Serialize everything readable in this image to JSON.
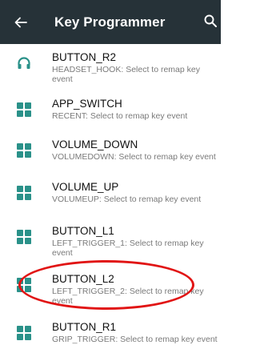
{
  "appbar": {
    "title": "Key Programmer",
    "back_icon": "arrow-back-icon",
    "search_icon": "search-icon",
    "background": "#263238"
  },
  "accent_color": "#2a9189",
  "highlight_color": "#e11414",
  "items": [
    {
      "name": "BUTTON_R2",
      "desc": "HEADSET_HOOK: Select to remap key event",
      "icon": "headset-icon"
    },
    {
      "name": "APP_SWITCH",
      "desc": "RECENT: Select to remap key event",
      "icon": "grid-icon"
    },
    {
      "name": "VOLUME_DOWN",
      "desc": "VOLUMEDOWN: Select to remap key event",
      "icon": "grid-icon"
    },
    {
      "name": "VOLUME_UP",
      "desc": "VOLUMEUP: Select to remap key event",
      "icon": "grid-icon"
    },
    {
      "name": "BUTTON_L1",
      "desc": "LEFT_TRIGGER_1: Select to remap key event",
      "icon": "grid-icon"
    },
    {
      "name": "BUTTON_L2",
      "desc": "LEFT_TRIGGER_2: Select to remap key event",
      "icon": "grid-icon",
      "highlighted": true
    },
    {
      "name": "BUTTON_R1",
      "desc": "GRIP_TRIGGER: Select to remap key event",
      "icon": "grid-icon"
    }
  ]
}
